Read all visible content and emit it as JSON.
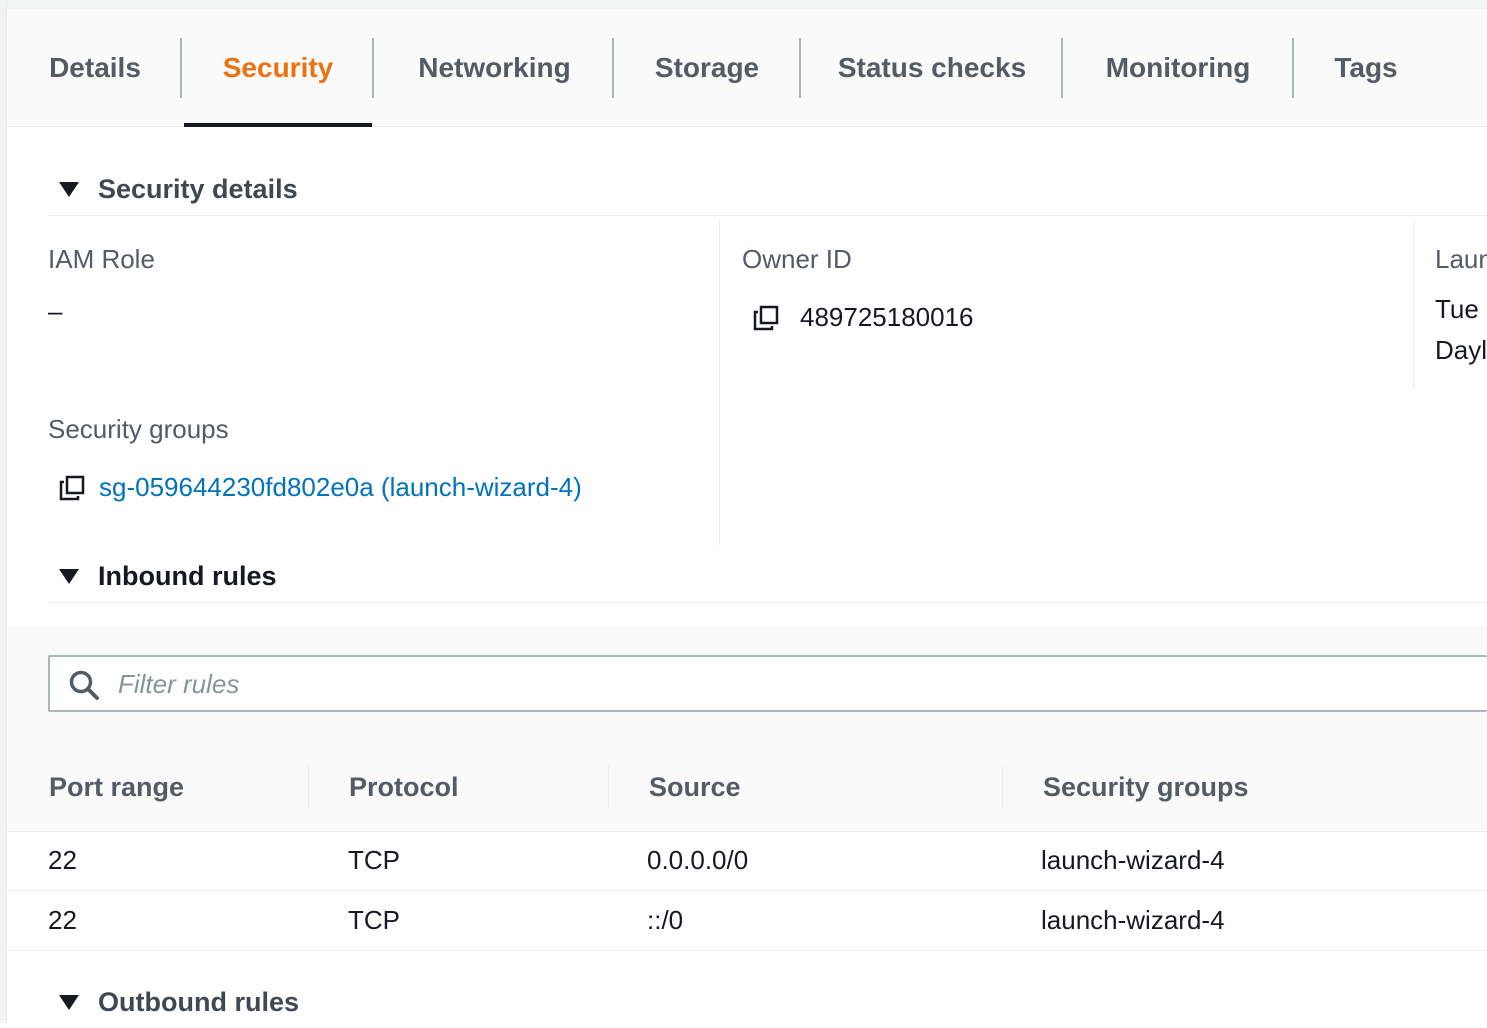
{
  "tabs": [
    {
      "label": "Details"
    },
    {
      "label": "Security"
    },
    {
      "label": "Networking"
    },
    {
      "label": "Storage"
    },
    {
      "label": "Status checks"
    },
    {
      "label": "Monitoring"
    },
    {
      "label": "Tags"
    }
  ],
  "active_tab": "Security",
  "security_details": {
    "title": "Security details",
    "iam_role_label": "IAM Role",
    "iam_role_value": "–",
    "owner_id_label": "Owner ID",
    "owner_id_value": "489725180016",
    "launch_time_label": "Laun",
    "launch_time_value_line1": "Tue",
    "launch_time_value_line2": "Dayl",
    "security_groups_label": "Security groups",
    "security_groups_value": "sg-059644230fd802e0a (launch-wizard-4)"
  },
  "inbound_rules": {
    "title": "Inbound rules",
    "filter_placeholder": "Filter rules",
    "columns": [
      "Port range",
      "Protocol",
      "Source",
      "Security groups"
    ],
    "rows": [
      {
        "port_range": "22",
        "protocol": "TCP",
        "source": "0.0.0.0/0",
        "security_groups": "launch-wizard-4"
      },
      {
        "port_range": "22",
        "protocol": "TCP",
        "source": "::/0",
        "security_groups": "launch-wizard-4"
      }
    ]
  },
  "outbound_rules": {
    "title": "Outbound rules"
  },
  "colors": {
    "active_tab": "#ec7211",
    "link": "#0073bb",
    "text": "#16191f",
    "muted_text": "#545b64"
  },
  "icons": [
    "copy-icon",
    "search-icon",
    "caret-down-icon"
  ]
}
